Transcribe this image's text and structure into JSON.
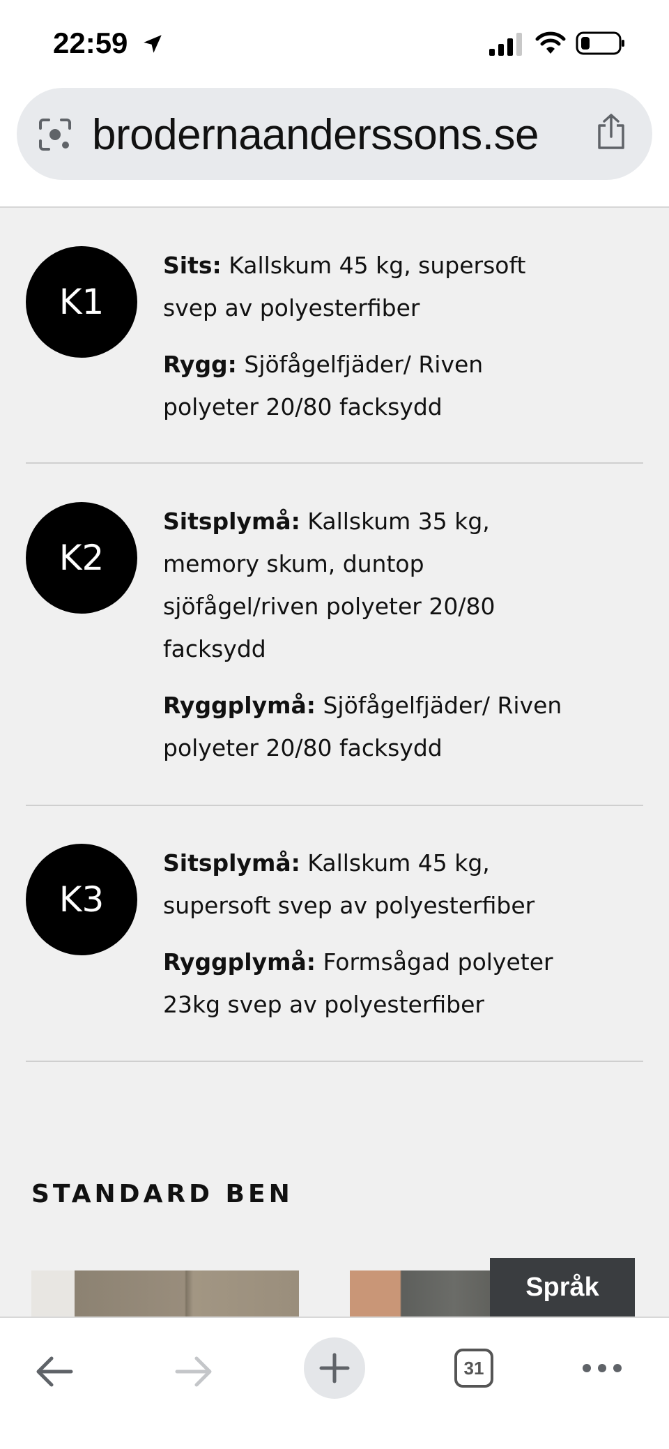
{
  "status_bar": {
    "time": "22:59",
    "icons": [
      "location-arrow-icon",
      "cellular-signal-icon",
      "wifi-icon",
      "battery-icon"
    ]
  },
  "url_bar": {
    "url": "brodernaanderssons.se",
    "left_icon": "lens-icon",
    "right_icon": "share-icon"
  },
  "comfort_items": [
    {
      "code": "K1",
      "paragraphs": [
        {
          "label": "Sits:",
          "text": " Kallskum 45 kg, supersoft svep av polyesterfiber"
        },
        {
          "label": "Rygg:",
          "text": " Sjöfågelfjäder/ Riven polyeter 20/80 facksydd"
        }
      ]
    },
    {
      "code": "K2",
      "paragraphs": [
        {
          "label": "Sitsplymå:",
          "text": " Kallskum 35 kg, memory skum, duntop sjöfågel/riven polyeter 20/80 facksydd"
        },
        {
          "label": "Ryggplymå:",
          "text": " Sjöfågelfjäder/ Riven polyeter 20/80 facksydd"
        }
      ]
    },
    {
      "code": "K3",
      "paragraphs": [
        {
          "label": "Sitsplymå:",
          "text": " Kallskum 45 kg, supersoft svep av polyesterfiber"
        },
        {
          "label": "Ryggplymå:",
          "text": " Formsågad polyeter 23kg svep av polyesterfiber"
        }
      ]
    }
  ],
  "section": {
    "heading": "STANDARD BEN"
  },
  "language_button": "Språk",
  "toolbar": {
    "tab_count": "31",
    "icons": [
      "back-arrow-icon",
      "forward-arrow-icon",
      "plus-icon",
      "tabs-icon",
      "more-dots-icon"
    ]
  },
  "colors": {
    "content_bg": "#f0f0f0",
    "circle_bg": "#000000",
    "language_button_bg": "#3a3d40",
    "url_bar_bg": "#e8eaed"
  }
}
